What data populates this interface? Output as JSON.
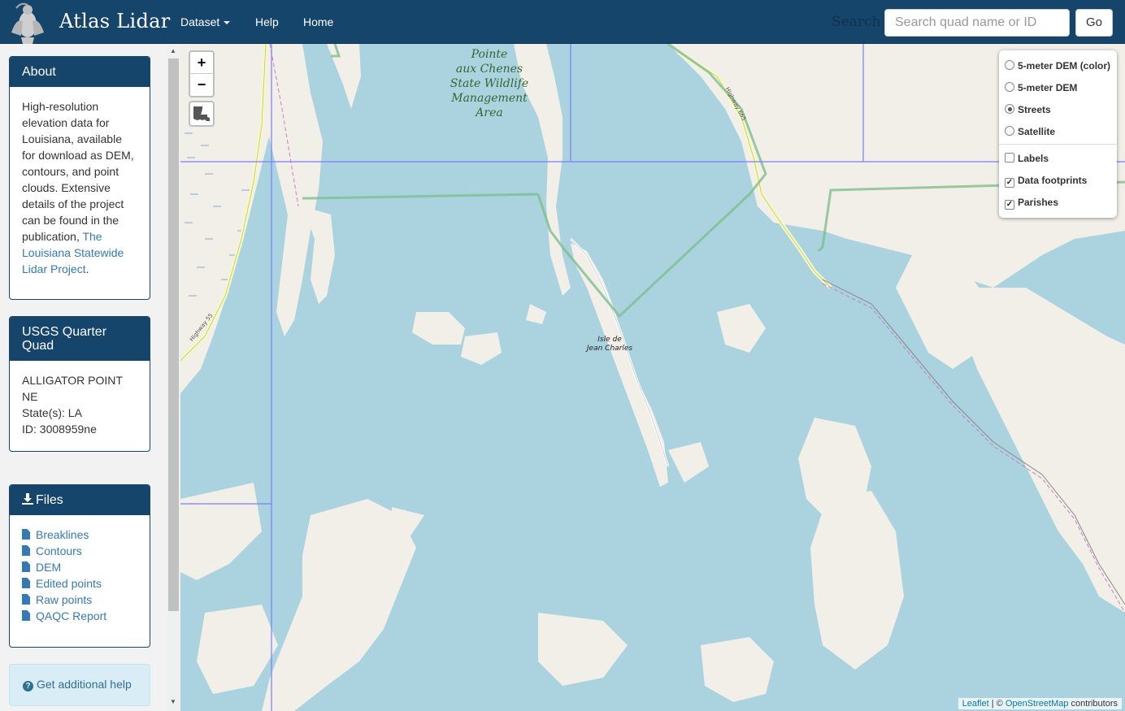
{
  "navbar": {
    "brand": "Atlas Lidar",
    "items": [
      {
        "label": "Dataset",
        "has_caret": true
      },
      {
        "label": "Help"
      },
      {
        "label": "Home"
      }
    ],
    "search_label": "Search",
    "search_placeholder": "Search quad name or ID",
    "go_label": "Go"
  },
  "sidebar": {
    "about": {
      "title": "About",
      "body": "High-resolution elevation data for Louisiana, available for download as DEM, contours, and point clouds. Extensive details of the project can be found in the publication,",
      "link": "The Louisiana Statewide Lidar Project",
      "end": "."
    },
    "quad": {
      "title": "USGS Quarter Quad",
      "name": "ALLIGATOR POINT NE",
      "states": "State(s): LA",
      "id": "ID: 3008959ne"
    },
    "files": {
      "title": "Files",
      "items": [
        "Breaklines",
        "Contours",
        "DEM",
        "Edited points",
        "Raw points",
        "QAQC Report"
      ]
    },
    "help": "Get additional help"
  },
  "map": {
    "zoom_in": "+",
    "zoom_out": "−",
    "labels": {
      "wildlife_area": [
        "Pointe",
        "aux Chenes",
        "State Wildlife",
        "Management",
        "Area"
      ],
      "town": [
        "Isle de",
        "Jean Charles"
      ],
      "highway_55": "Highway 55",
      "highway_665": "Highway 665"
    },
    "layers": {
      "base": [
        {
          "label": "5-meter DEM (color)",
          "selected": false
        },
        {
          "label": "5-meter DEM",
          "selected": false
        },
        {
          "label": "Streets",
          "selected": true
        },
        {
          "label": "Satellite",
          "selected": false
        }
      ],
      "overlays": [
        {
          "label": "Labels",
          "checked": false
        },
        {
          "label": "Data footprints",
          "checked": true
        },
        {
          "label": "Parishes",
          "checked": true
        }
      ]
    },
    "attribution": {
      "leaflet": "Leaflet",
      "sep": " | © ",
      "osm": "OpenStreetMap",
      "suffix": " contributors"
    }
  },
  "colors": {
    "navbar": "#16456b",
    "water": "#aad3df",
    "land": "#f2efe9",
    "link": "#337ab7",
    "footprint": "#7b7bff",
    "parish": "#7fbf8f"
  }
}
